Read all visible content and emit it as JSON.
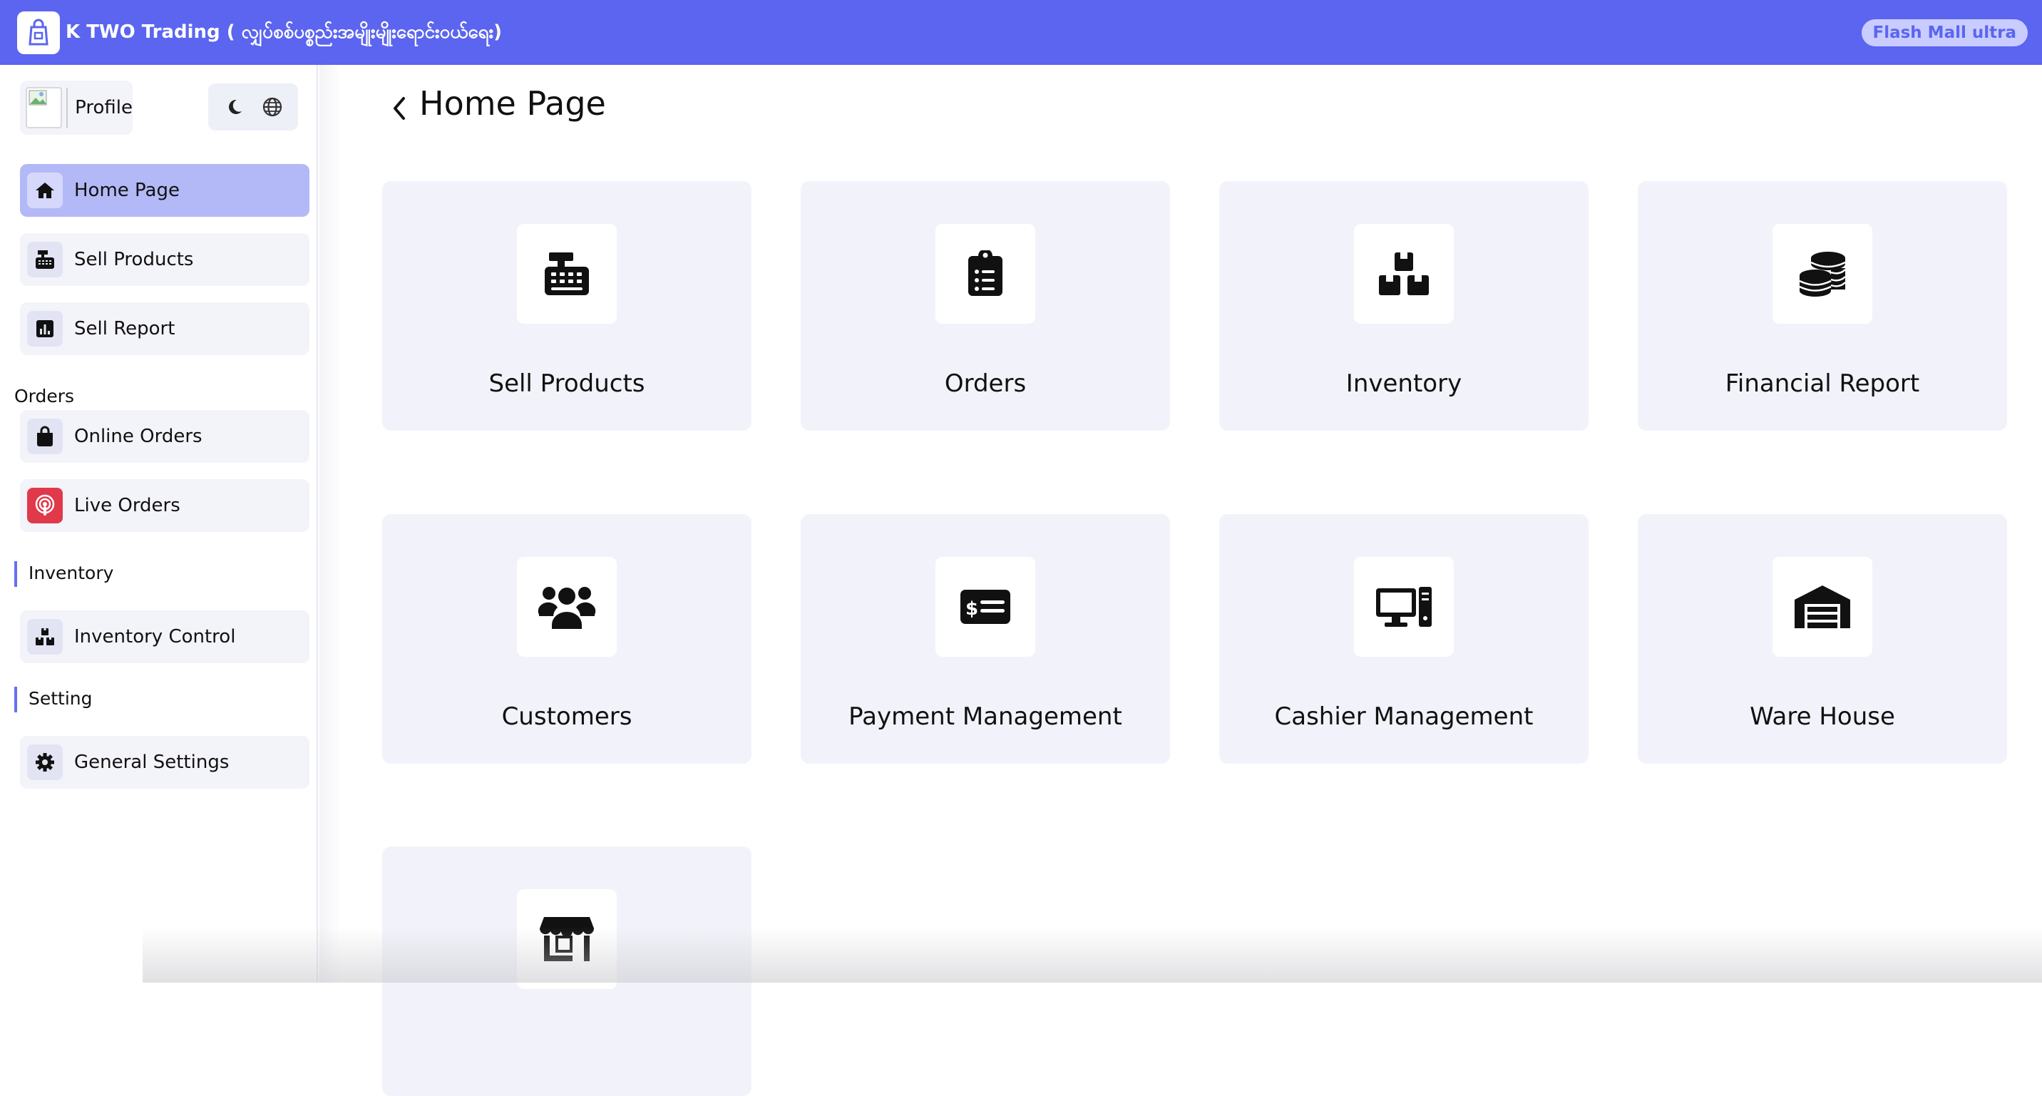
{
  "app": {
    "title": "K TWO Trading ( လျှပ်စစ်ပစ္စည်းအမျိုးမျိုးရောင်းဝယ်ရေး)",
    "badge": "Flash Mall ultra",
    "accent_color": "#5b65f0"
  },
  "sidebar": {
    "profile_label": "Profile",
    "tools": [
      {
        "icon": "moon-icon"
      },
      {
        "icon": "globe-icon"
      }
    ],
    "items": [
      {
        "label": "Home Page",
        "icon": "home-icon",
        "active": true
      },
      {
        "label": "Sell Products",
        "icon": "cash-register-icon"
      },
      {
        "label": "Sell Report",
        "icon": "chart-icon"
      }
    ],
    "sections": {
      "orders": {
        "label": "Orders",
        "items": [
          {
            "label": "Online Orders",
            "icon": "shopping-bag-icon"
          },
          {
            "label": "Live Orders",
            "icon": "podcast-icon"
          }
        ]
      },
      "inventory": {
        "label": "Inventory",
        "items": [
          {
            "label": "Inventory Control",
            "icon": "boxes-icon"
          }
        ]
      },
      "setting": {
        "label": "Setting",
        "items": [
          {
            "label": "General Settings",
            "icon": "gear-icon"
          }
        ]
      }
    }
  },
  "main": {
    "page_title": "Home Page",
    "cards": [
      {
        "label": "Sell Products",
        "icon": "cash-register-icon"
      },
      {
        "label": "Orders",
        "icon": "clipboard-list-icon"
      },
      {
        "label": "Inventory",
        "icon": "boxes-icon"
      },
      {
        "label": "Financial Report",
        "icon": "coins-icon"
      },
      {
        "label": "Customers",
        "icon": "users-icon"
      },
      {
        "label": "Payment Management",
        "icon": "money-check-icon"
      },
      {
        "label": "Cashier Management",
        "icon": "computer-icon"
      },
      {
        "label": "Ware House",
        "icon": "warehouse-icon"
      },
      {
        "label": "",
        "icon": "store-icon"
      }
    ]
  }
}
